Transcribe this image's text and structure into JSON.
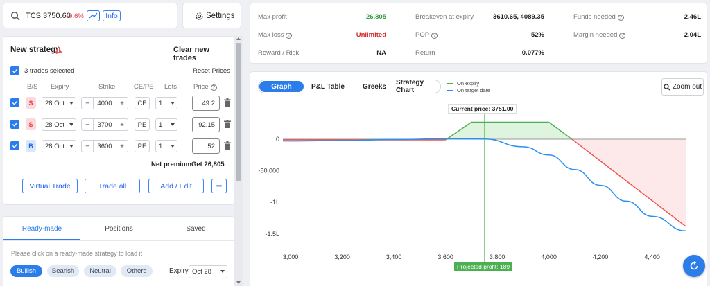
{
  "ticker": {
    "symbol": "TCS 3750.60",
    "change": "-0.6%",
    "info_label": "Info"
  },
  "settings_label": "Settings",
  "strategy": {
    "title": "New strategy",
    "clear_label": "Clear new trades",
    "selected_label": "3 trades selected",
    "reset_label": "Reset Prices",
    "headers": {
      "bs": "B/S",
      "expiry": "Expiry",
      "strike": "Strike",
      "type": "CE/PE",
      "lots": "Lots",
      "price": "Price"
    },
    "legs": [
      {
        "side": "S",
        "expiry": "28 Oct",
        "strike": "4000",
        "type": "CE",
        "lots": "1",
        "price": "49.2"
      },
      {
        "side": "S",
        "expiry": "28 Oct",
        "strike": "3700",
        "type": "PE",
        "lots": "1",
        "price": "92.15"
      },
      {
        "side": "B",
        "expiry": "28 Oct",
        "strike": "3600",
        "type": "PE",
        "lots": "1",
        "price": "52"
      }
    ],
    "net_premium_label": "Net premium",
    "net_premium_value": "Get 26,805",
    "buttons": {
      "virtual": "Virtual Trade",
      "trade_all": "Trade all",
      "add_edit": "Add / Edit",
      "more": "•••"
    }
  },
  "lower_tabs": [
    "Ready-made",
    "Positions",
    "Saved"
  ],
  "readymade": {
    "hint": "Please click on a ready-made strategy to load it",
    "filters": [
      "Bullish",
      "Bearish",
      "Neutral",
      "Others"
    ],
    "expiry_label": "Expiry",
    "expiry_value": "Oct 28"
  },
  "metrics": {
    "max_profit": {
      "label": "Max profit",
      "value": "26,805"
    },
    "max_loss": {
      "label": "Max loss",
      "value": "Unlimited"
    },
    "reward_risk": {
      "label": "Reward / Risk",
      "value": "NA"
    },
    "breakeven": {
      "label": "Breakeven at expiry",
      "value": "3610.65, 4089.35"
    },
    "pop": {
      "label": "POP",
      "value": "52%"
    },
    "return": {
      "label": "Return",
      "value": "0.077%"
    },
    "funds": {
      "label": "Funds needed",
      "value": "2.46L"
    },
    "margin": {
      "label": "Margin needed",
      "value": "2.04L"
    }
  },
  "chart_tabs": [
    "Graph",
    "P&L Table",
    "Greeks",
    "Strategy Chart"
  ],
  "legend": {
    "expiry": "On expiry",
    "target": "On target date"
  },
  "zoom_label": "Zoom out",
  "colors": {
    "expiry": "#4caf50",
    "target": "#2b8ff0",
    "loss": "#ef5350",
    "accent": "#2b7de9"
  },
  "chart_data": {
    "type": "line",
    "x_ticks": [
      "3,000",
      "3,200",
      "3,400",
      "3,600",
      "3,800",
      "4,000",
      "4,200",
      "4,400"
    ],
    "y_ticks": [
      "0",
      "-50,000",
      "-1L",
      "-1.5L"
    ],
    "xlim": [
      2970,
      4530
    ],
    "ylim": [
      -160000,
      35000
    ],
    "current_price_label": "Current price: 3751.00",
    "current_price": 3751,
    "projected_label": "Projected profit: 189",
    "series": [
      {
        "name": "On expiry",
        "x": [
          2970,
          3600,
          3700,
          4000,
          4089,
          4530
        ],
        "y": [
          -1200,
          -1200,
          26805,
          26805,
          0,
          -138000
        ]
      },
      {
        "name": "On target date",
        "x": [
          2970,
          3200,
          3400,
          3600,
          3750,
          3900,
          4000,
          4100,
          4200,
          4300,
          4400,
          4530
        ],
        "y": [
          -3000,
          -2200,
          -600,
          600,
          189,
          -12000,
          -25000,
          -48000,
          -73000,
          -98000,
          -122000,
          -145000
        ]
      }
    ]
  }
}
